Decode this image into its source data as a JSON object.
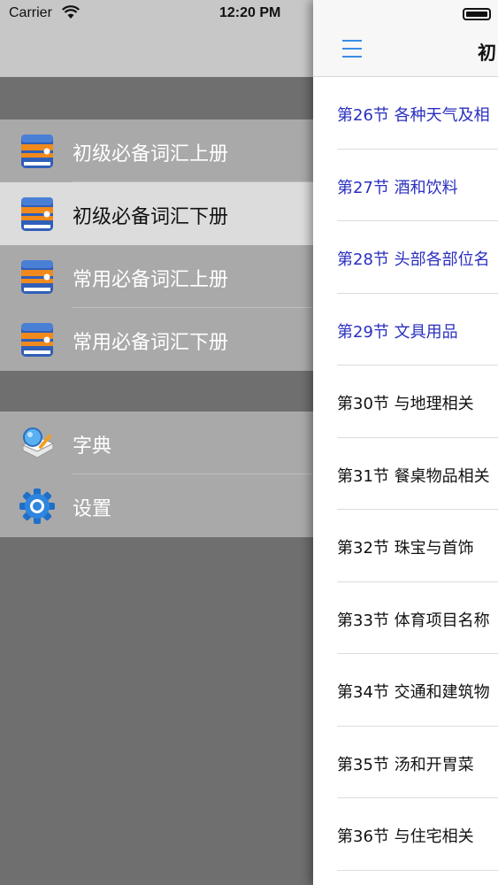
{
  "status_bar": {
    "carrier": "Carrier",
    "time": "12:20 PM"
  },
  "menu": {
    "books": [
      {
        "label": "初级必备词汇上册",
        "icon": "book-icon",
        "selected": false
      },
      {
        "label": "初级必备词汇下册",
        "icon": "book-icon",
        "selected": true
      },
      {
        "label": "常用必备词汇上册",
        "icon": "book-icon",
        "selected": false
      },
      {
        "label": "常用必备词汇下册",
        "icon": "book-icon",
        "selected": false
      }
    ],
    "tools": [
      {
        "label": "字典",
        "icon": "dictionary-icon"
      },
      {
        "label": "设置",
        "icon": "gear-icon"
      }
    ]
  },
  "panel": {
    "title": "初",
    "lessons": [
      {
        "label": "第26节 各种天气及相",
        "visited": true
      },
      {
        "label": "第27节 酒和饮料",
        "visited": true
      },
      {
        "label": "第28节 头部各部位名",
        "visited": true
      },
      {
        "label": "第29节 文具用品",
        "visited": true
      },
      {
        "label": "第30节 与地理相关",
        "visited": false
      },
      {
        "label": "第31节 餐桌物品相关",
        "visited": false
      },
      {
        "label": "第32节 珠宝与首饰",
        "visited": false
      },
      {
        "label": "第33节 体育项目名称",
        "visited": false
      },
      {
        "label": "第34节 交通和建筑物",
        "visited": false
      },
      {
        "label": "第35节 汤和开胃菜",
        "visited": false
      },
      {
        "label": "第36节 与住宅相关",
        "visited": false
      }
    ]
  },
  "colors": {
    "visited_link": "#2a2fbf",
    "accent": "#3a8ee6",
    "selected_row": "#dcdcdc",
    "menu_row": "#a9a9a9"
  }
}
